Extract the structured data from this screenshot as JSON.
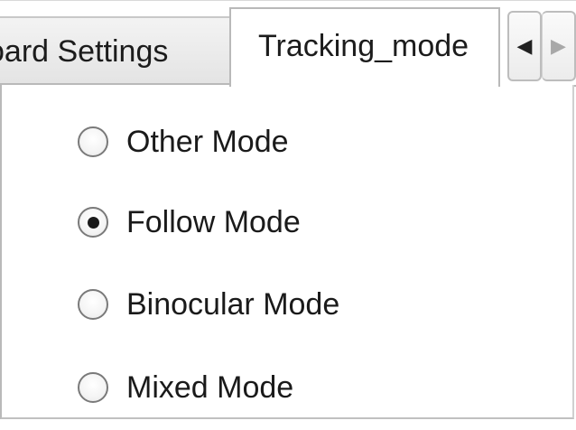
{
  "tabs": {
    "inactive_label": "oard Settings",
    "active_label": "Tracking_mode",
    "scroll_left_glyph": "◀",
    "scroll_right_glyph": "▶"
  },
  "modes": {
    "selected": "Follow Mode",
    "options": [
      {
        "label": "Other Mode",
        "checked": false
      },
      {
        "label": "Follow Mode",
        "checked": true
      },
      {
        "label": "Binocular Mode",
        "checked": false
      },
      {
        "label": "Mixed Mode",
        "checked": false
      }
    ]
  }
}
